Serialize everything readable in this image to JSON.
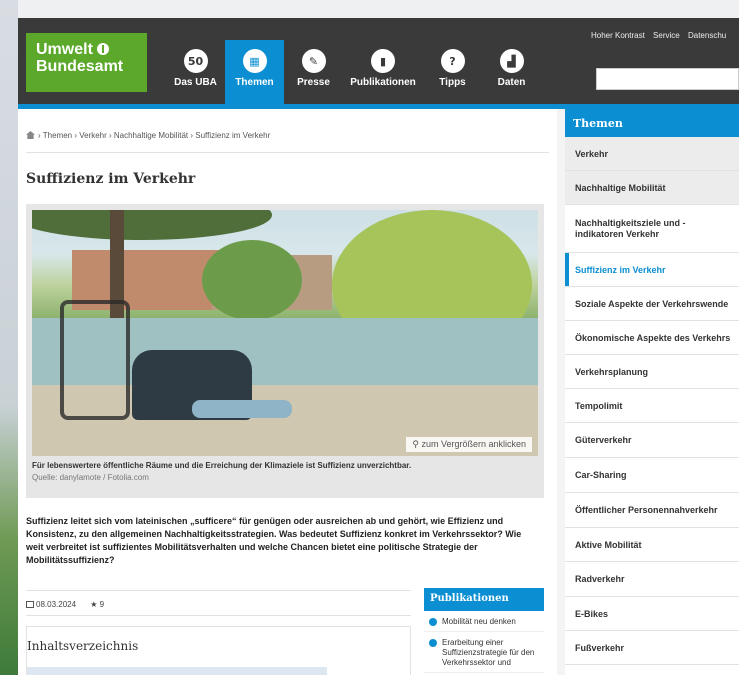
{
  "header": {
    "logo_line1": "Umwelt",
    "logo_line2": "Bundesamt",
    "nav": [
      {
        "label": "Das UBA",
        "icon": "50"
      },
      {
        "label": "Themen",
        "icon": "▦"
      },
      {
        "label": "Presse",
        "icon": "✎"
      },
      {
        "label": "Publikationen",
        "icon": "▮"
      },
      {
        "label": "Tipps",
        "icon": "?"
      },
      {
        "label": "Daten",
        "icon": "▟"
      }
    ],
    "toplinks": [
      "Hoher Kontrast",
      "Service",
      "Datenschu"
    ]
  },
  "breadcrumb": "› Themen › Verkehr › Nachhaltige Mobilität › Suffizienz im Verkehr",
  "title": "Suffizienz im Verkehr",
  "figure": {
    "zoom_hint": "zum Vergrößern anklicken",
    "caption": "Für lebenswertere öffentliche Räume und die Erreichung der Klimaziele ist Suffizienz unverzichtbar.",
    "source": "Quelle: danylamote / Fotolia.com"
  },
  "intro": "Suffizienz leitet sich vom lateinischen „sufficere“ für genügen oder ausreichen ab und gehört, wie Effizienz und Konsistenz, zu den allgemeinen Nachhaltigkeitsstrategien. Was bedeutet Suffizienz konkret im Verkehrssektor? Wie weit verbreitet ist suffizientes Mobilitätsverhalten und welche Chancen bietet eine politische Strategie der Mobilitätssuffizienz?",
  "meta": {
    "date": "08.03.2024",
    "stars": "★ 9"
  },
  "toc": {
    "title": "Inhaltsverzeichnis"
  },
  "publications": {
    "title": "Publikationen",
    "items": [
      "Mobilität neu denken",
      "Erarbeitung einer Suffizienzstrategie für den Verkehrssektor und"
    ]
  },
  "sidebar": {
    "title": "Themen",
    "items": [
      "Verkehr",
      "Nachhaltige Mobilität",
      "Nachhaltigkeitsziele und -indikatoren Verkehr",
      "Suffizienz im Verkehr",
      "Soziale Aspekte der Verkehrswende",
      "Ökonomische Aspekte des Verkehrs",
      "Verkehrsplanung",
      "Tempolimit",
      "Güterverkehr",
      "Car-Sharing",
      "Öffentlicher Personennahverkehr",
      "Aktive Mobilität",
      "Radverkehr",
      "E-Bikes",
      "Fußverkehr"
    ]
  }
}
